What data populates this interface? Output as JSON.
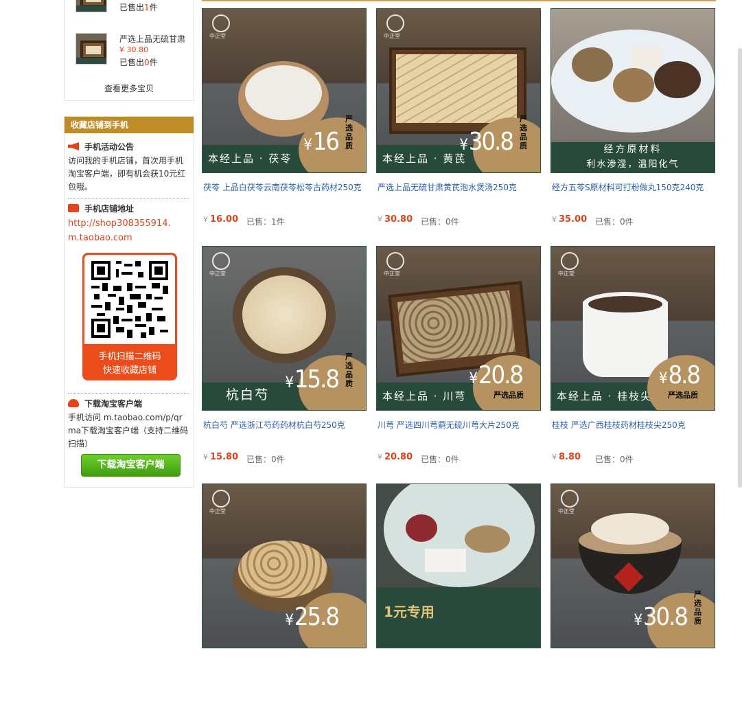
{
  "sidebar": {
    "mini_items": [
      {
        "title": "",
        "price": "",
        "sold_prefix": "已售出",
        "sold_num": "1",
        "sold_suffix": "件"
      },
      {
        "title": "严选上品无硫甘肃",
        "price": "¥ 30.80",
        "sold_prefix": "已售出",
        "sold_num": "0",
        "sold_suffix": "件"
      }
    ],
    "more_label": "查看更多宝贝",
    "mobile_header": "收藏店铺到手机",
    "activity_title": "手机活动公告",
    "activity_text": "访问我的手机店铺，首次用手机淘宝客户端，即有机会获10元红包哦。",
    "address_title": "手机店铺地址",
    "shop_url": "http://shop308355914.m.taobao.com",
    "qr_text_1": "手机扫描二维码",
    "qr_text_2": "快速收藏店铺",
    "download_title": "下载淘宝客户端",
    "download_text": "手机访问 m.taobao.com/p/qrma下载淘宝客户端（支持二维码 扫描）",
    "download_button": "下载淘宝客户端"
  },
  "products": [
    {
      "title": "茯苓 上品白茯苓云南茯苓松苓古药材250克",
      "price": "16.00",
      "sold": "已售：1件",
      "band": "本经上品 · 茯苓",
      "badge_num": "16",
      "badge_side": "严选品质"
    },
    {
      "title": "严选上品无硫甘肃黄芪泡水煲汤250克",
      "price": "30.80",
      "sold": "已售：0件",
      "band": "本经上品 · 黄芪",
      "badge_num": "30.8",
      "badge_side": "严选品质"
    },
    {
      "title": "经方五苓S原材料可打粉做丸150克240克",
      "price": "35.00",
      "sold": "已售：0件",
      "band": "经方原材料",
      "band2": "利水渗湿，温阳化气"
    },
    {
      "title": "杭白芍 严选浙江芍药药材杭白芍250克",
      "price": "15.80",
      "sold": "已售：0件",
      "band": "杭白芍",
      "badge_num": "15.8",
      "badge_side": "严选品质"
    },
    {
      "title": "川芎 严选四川芎藭无硫川芎大片250克",
      "price": "20.80",
      "sold": "已售：0件",
      "band": "本经上品 · 川芎",
      "badge_num": "20.8",
      "badge_bottom": "严选品质"
    },
    {
      "title": "桂枝 严选广西桂枝药材桂枝尖250克",
      "price": "8.80",
      "sold": "已售：0件",
      "band": "本经上品 · 桂枝尖",
      "badge_num": "8.8",
      "badge_bottom": "严选品质"
    },
    {
      "badge_num": "25.8"
    },
    {
      "band": "1元专用"
    },
    {
      "badge_num": "30.8",
      "badge_side": "严选品质"
    }
  ],
  "colors": {
    "accent_gold": "#bf8d27",
    "price_red": "#e0421a",
    "band_green": "#284a3b",
    "badge_tan": "#b59260",
    "link_blue": "#2a5ea8"
  },
  "logo_text": "中正堂"
}
